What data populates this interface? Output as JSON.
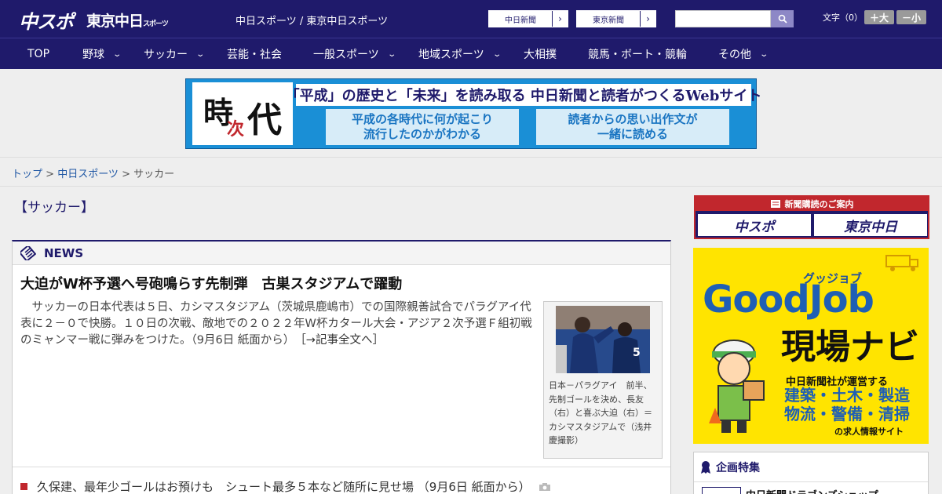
{
  "header": {
    "logo_main": "中スポ",
    "logo_tokyo": "東京中日",
    "logo_tokyo_sub": "スポーツ",
    "site_links": "中日スポーツ / 東京中日スポーツ",
    "paper_buttons": [
      "中日新聞",
      "東京新聞"
    ],
    "search_placeholder": "",
    "font_size_label": "文字（0）",
    "font_plus": "＋大",
    "font_minus": "－小"
  },
  "nav": {
    "items": [
      {
        "label": "TOP",
        "has_menu": false
      },
      {
        "label": "野球",
        "has_menu": true
      },
      {
        "label": "サッカー",
        "has_menu": true
      },
      {
        "label": "芸能・社会",
        "has_menu": false
      },
      {
        "label": "一般スポーツ",
        "has_menu": true
      },
      {
        "label": "地域スポーツ",
        "has_menu": true
      },
      {
        "label": "大相撲",
        "has_menu": false
      },
      {
        "label": "競馬・ボート・競輪",
        "has_menu": false
      },
      {
        "label": "その他",
        "has_menu": true
      }
    ]
  },
  "banner": {
    "logo_chars": [
      "時",
      "次",
      "代"
    ],
    "headline": "「平成」の歴史と「未来」を読み取る 中日新聞と読者がつくるWebサイト",
    "left_text": "平成の各時代に何が起こり\n流行したのかがわかる",
    "right_text": "読者からの思い出作文が\n一緒に読める"
  },
  "breadcrumb": {
    "items": [
      "トップ",
      "中日スポーツ"
    ],
    "current": "サッカー",
    "separator": " > "
  },
  "section_title": "【サッカー】",
  "news": {
    "heading": "NEWS",
    "lead_title": "大迫がW杯予選へ号砲鳴らす先制弾　古巣スタジアムで躍動",
    "lead_body": "サッカーの日本代表は５日、カシマスタジアム（茨城県鹿嶋市）での国際親善試合でパラグアイ代表に２－０で快勝。１０日の次戦、敵地での２０２２年W杯カタール大会・アジア２次予選Ｆ組初戦のミャンマー戦に弾みをつけた。（9月6日 紙面から）",
    "lead_more": "［→記事全文へ］",
    "photo_caption": "日本－パラグアイ　前半、先制ゴールを決め、長友（右）と喜ぶ大迫（右）＝カシマスタジアムで（浅井慶撮影）",
    "list": [
      {
        "text": "久保建、最年少ゴールはお預けも　シュート最多５本など随所に見せ場 （9月6日 紙面から）",
        "has_photo": true
      }
    ]
  },
  "sidebar": {
    "subscribe_band": "新聞購読のご案内",
    "subscribe_logos": [
      "中スポ",
      "東京中日"
    ],
    "goodjob": {
      "kana": "グッジョブ",
      "title": "GoodJob",
      "subtitle": "現場ナビ",
      "operator": "中日新聞社が運営する",
      "fields": "建築・土木・製造\n物流・警備・清掃",
      "tagline": "の求人情報サイト"
    },
    "feature": {
      "heading": "企画特集",
      "item": "中日新聞ドラゴンズショップ"
    }
  },
  "colors": {
    "brand_navy": "#1f1a6b",
    "accent_red": "#c1272d",
    "goodjob_yellow": "#ffe400",
    "banner_blue": "#1a8fd6"
  }
}
